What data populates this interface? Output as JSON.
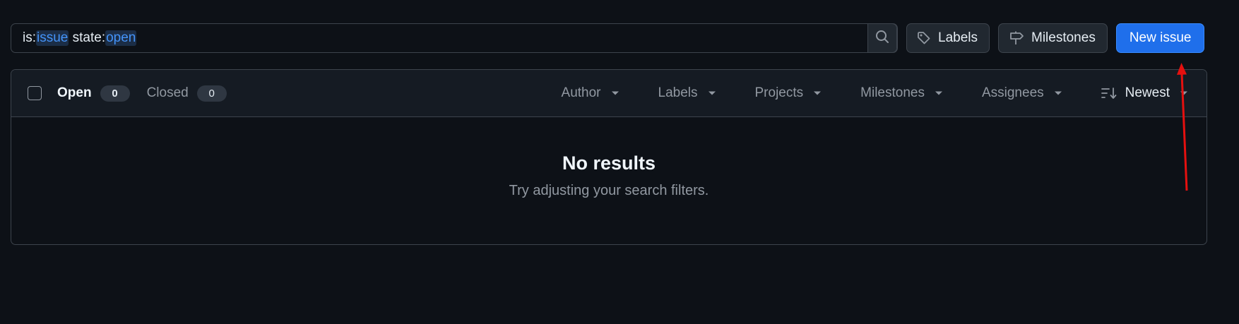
{
  "search": {
    "query_parts": [
      {
        "text": "is:",
        "highlight": false
      },
      {
        "text": "issue",
        "highlight": true
      },
      {
        "text": " state:",
        "highlight": false
      },
      {
        "text": "open",
        "highlight": true
      }
    ],
    "icon": "search-icon"
  },
  "toolbar": {
    "labels_label": "Labels",
    "milestones_label": "Milestones",
    "new_issue_label": "New issue"
  },
  "list": {
    "open_label": "Open",
    "open_count": "0",
    "closed_label": "Closed",
    "closed_count": "0",
    "filters": {
      "author": "Author",
      "labels": "Labels",
      "projects": "Projects",
      "milestones": "Milestones",
      "assignees": "Assignees",
      "sort": "Newest"
    },
    "empty_title": "No results",
    "empty_subtitle": "Try adjusting your search filters."
  },
  "colors": {
    "background": "#0d1117",
    "primary_button": "#1f6feb",
    "highlight_token": "#4493f8",
    "annotation_arrow": "#e5100f"
  }
}
